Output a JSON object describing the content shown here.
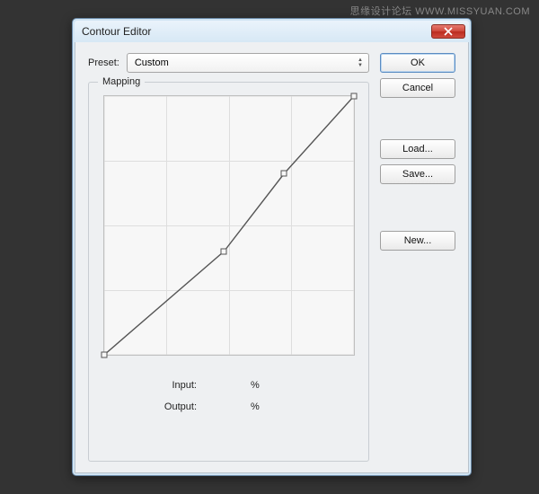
{
  "watermark": "思缘设计论坛 WWW.MISSYUAN.COM",
  "dialog": {
    "title": "Contour Editor",
    "preset_label": "Preset:",
    "preset_value": "Custom",
    "mapping_label": "Mapping",
    "input_label": "Input:",
    "input_value": "",
    "output_label": "Output:",
    "output_value": "",
    "percent": "%"
  },
  "buttons": {
    "ok": "OK",
    "cancel": "Cancel",
    "load": "Load...",
    "save": "Save...",
    "new": "New..."
  },
  "chart_data": {
    "type": "line",
    "title": "Mapping",
    "xlabel": "Input",
    "ylabel": "Output",
    "xlim": [
      0,
      100
    ],
    "ylim": [
      0,
      100
    ],
    "series": [
      {
        "name": "contour",
        "points": [
          {
            "x": 0,
            "y": 0
          },
          {
            "x": 48,
            "y": 40
          },
          {
            "x": 72,
            "y": 70
          },
          {
            "x": 100,
            "y": 100
          }
        ]
      }
    ]
  }
}
